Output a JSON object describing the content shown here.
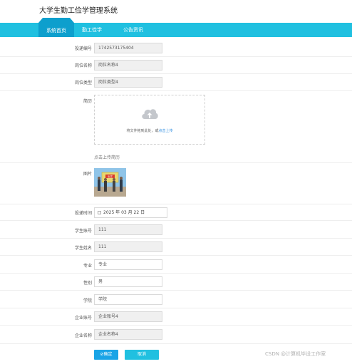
{
  "app": {
    "title": "大学生勤工俭学管理系统"
  },
  "nav": {
    "items": [
      {
        "label": "系统首页"
      },
      {
        "label": "勤工俭学"
      },
      {
        "label": "公告资讯"
      }
    ]
  },
  "form": {
    "delivery_id": {
      "label": "投递编号",
      "value": "1742573175404"
    },
    "job_name": {
      "label": "岗位名称",
      "value": "岗位名称4"
    },
    "job_type": {
      "label": "岗位类型",
      "value": "岗位类型4"
    },
    "resume": {
      "label": "简历",
      "drop_text": "将文件拖到此处，或",
      "drop_link": "点击上传",
      "tip": "点击上传简历"
    },
    "image": {
      "label": "图片",
      "banner_text": "出发"
    },
    "delivery_time": {
      "label": "投递时间",
      "value": "2025 年 03 月 22 日"
    },
    "student_account": {
      "label": "学生账号",
      "value": "111"
    },
    "student_name": {
      "label": "学生姓名",
      "value": "111"
    },
    "major": {
      "label": "专业",
      "value": "专业"
    },
    "gender": {
      "label": "性别",
      "value": "男"
    },
    "college": {
      "label": "学院",
      "value": "学院"
    },
    "company_account": {
      "label": "企业账号",
      "value": "企业账号4"
    },
    "company_name": {
      "label": "企业名称",
      "value": "企业名称4"
    }
  },
  "actions": {
    "confirm": "确定",
    "cancel": "取消"
  },
  "watermark": "CSDN @计算机毕设工作室",
  "colors": {
    "nav": "#20c0e0",
    "nav_active": "#0d9fcd",
    "link": "#2a8be0"
  }
}
